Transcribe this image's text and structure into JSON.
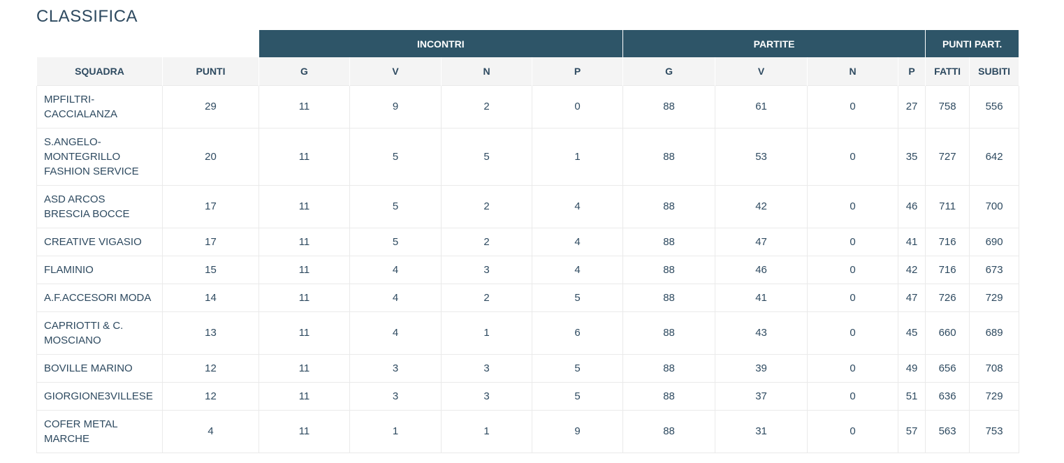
{
  "page_title": "CLASSIFICA",
  "groups": {
    "incontri": "INCONTRI",
    "partite": "PARTITE",
    "punti_part": "PUNTI PART."
  },
  "columns": {
    "squadra": "SQUADRA",
    "punti": "PUNTI",
    "inc_g": "G",
    "inc_v": "V",
    "inc_n": "N",
    "inc_p": "P",
    "par_g": "G",
    "par_v": "V",
    "par_n": "N",
    "par_p": "P",
    "fatti": "FATTI",
    "subiti": "SUBITI"
  },
  "rows": [
    {
      "squadra": "MPFILTRI-\nCACCIALANZA",
      "punti": "29",
      "inc_g": "11",
      "inc_v": "9",
      "inc_n": "2",
      "inc_p": "0",
      "par_g": "88",
      "par_v": "61",
      "par_n": "0",
      "par_p": "27",
      "fatti": "758",
      "subiti": "556"
    },
    {
      "squadra": "S.ANGELO-\nMONTEGRILLO\nFASHION SERVICE",
      "punti": "20",
      "inc_g": "11",
      "inc_v": "5",
      "inc_n": "5",
      "inc_p": "1",
      "par_g": "88",
      "par_v": "53",
      "par_n": "0",
      "par_p": "35",
      "fatti": "727",
      "subiti": "642"
    },
    {
      "squadra": "ASD ARCOS\nBRESCIA BOCCE",
      "punti": "17",
      "inc_g": "11",
      "inc_v": "5",
      "inc_n": "2",
      "inc_p": "4",
      "par_g": "88",
      "par_v": "42",
      "par_n": "0",
      "par_p": "46",
      "fatti": "711",
      "subiti": "700"
    },
    {
      "squadra": "CREATIVE VIGASIO",
      "punti": "17",
      "inc_g": "11",
      "inc_v": "5",
      "inc_n": "2",
      "inc_p": "4",
      "par_g": "88",
      "par_v": "47",
      "par_n": "0",
      "par_p": "41",
      "fatti": "716",
      "subiti": "690"
    },
    {
      "squadra": "FLAMINIO",
      "punti": "15",
      "inc_g": "11",
      "inc_v": "4",
      "inc_n": "3",
      "inc_p": "4",
      "par_g": "88",
      "par_v": "46",
      "par_n": "0",
      "par_p": "42",
      "fatti": "716",
      "subiti": "673"
    },
    {
      "squadra": "A.F.ACCESORI MODA",
      "punti": "14",
      "inc_g": "11",
      "inc_v": "4",
      "inc_n": "2",
      "inc_p": "5",
      "par_g": "88",
      "par_v": "41",
      "par_n": "0",
      "par_p": "47",
      "fatti": "726",
      "subiti": "729"
    },
    {
      "squadra": "CAPRIOTTI & C.\nMOSCIANO",
      "punti": "13",
      "inc_g": "11",
      "inc_v": "4",
      "inc_n": "1",
      "inc_p": "6",
      "par_g": "88",
      "par_v": "43",
      "par_n": "0",
      "par_p": "45",
      "fatti": "660",
      "subiti": "689"
    },
    {
      "squadra": "BOVILLE MARINO",
      "punti": "12",
      "inc_g": "11",
      "inc_v": "3",
      "inc_n": "3",
      "inc_p": "5",
      "par_g": "88",
      "par_v": "39",
      "par_n": "0",
      "par_p": "49",
      "fatti": "656",
      "subiti": "708"
    },
    {
      "squadra": "GIORGIONE3VILLESE",
      "punti": "12",
      "inc_g": "11",
      "inc_v": "3",
      "inc_n": "3",
      "inc_p": "5",
      "par_g": "88",
      "par_v": "37",
      "par_n": "0",
      "par_p": "51",
      "fatti": "636",
      "subiti": "729"
    },
    {
      "squadra": "COFER METAL\nMARCHE",
      "punti": "4",
      "inc_g": "11",
      "inc_v": "1",
      "inc_n": "1",
      "inc_p": "9",
      "par_g": "88",
      "par_v": "31",
      "par_n": "0",
      "par_p": "57",
      "fatti": "563",
      "subiti": "753"
    }
  ],
  "colors": {
    "header_bg": "#2e5568",
    "subheader_bg": "#f4f4f4",
    "text": "#2e4a60",
    "border": "#eaeaea"
  }
}
